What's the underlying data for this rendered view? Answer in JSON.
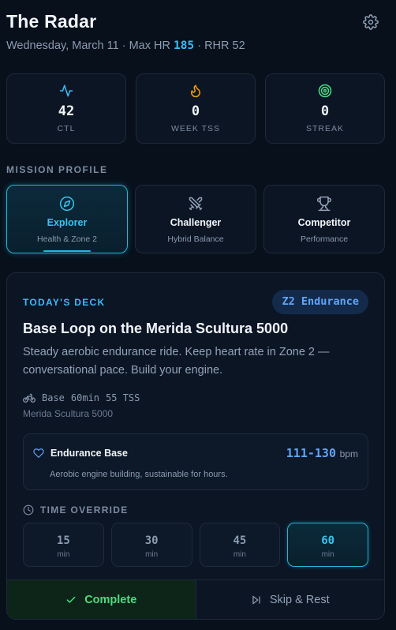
{
  "header": {
    "title": "The Radar",
    "date": "Wednesday, March 11",
    "max_hr_label": "Max HR",
    "max_hr_value": "185",
    "rhr_label": "RHR 52"
  },
  "stats": [
    {
      "value": "42",
      "label": "CTL",
      "icon": "activity-icon",
      "color": "#38bdf8"
    },
    {
      "value": "0",
      "label": "WEEK TSS",
      "icon": "flame-icon",
      "color": "#f59e0b"
    },
    {
      "value": "0",
      "label": "STREAK",
      "icon": "target-icon",
      "color": "#4ade80"
    }
  ],
  "mission": {
    "label": "MISSION PROFILE",
    "profiles": [
      {
        "name": "Explorer",
        "desc": "Health & Zone 2",
        "icon": "compass-icon",
        "active": true
      },
      {
        "name": "Challenger",
        "desc": "Hybrid Balance",
        "icon": "swords-icon",
        "active": false
      },
      {
        "name": "Competitor",
        "desc": "Performance",
        "icon": "trophy-icon",
        "active": false
      }
    ]
  },
  "deck": {
    "label": "TODAY'S DECK",
    "zone_badge": "Z2 Endurance",
    "title": "Base Loop on the Merida Scultura 5000",
    "description": "Steady aerobic endurance ride. Keep heart rate in Zone 2 — conversational pace. Build your engine.",
    "meta": {
      "type": "Base",
      "duration": "60min",
      "tss": "55 TSS"
    },
    "bike": "Merida Scultura 5000",
    "zone": {
      "name": "Endurance Base",
      "range": "111-130",
      "unit": "bpm",
      "desc": "Aerobic engine building, sustainable for hours."
    },
    "override": {
      "label": "TIME OVERRIDE",
      "unit": "min",
      "options": [
        "15",
        "30",
        "45",
        "60"
      ],
      "selected": "60"
    },
    "actions": {
      "complete": "Complete",
      "skip": "Skip & Rest"
    }
  },
  "colors": {
    "accent": "#22b8d9",
    "zone": "#60a5fa",
    "success": "#4ade80"
  }
}
